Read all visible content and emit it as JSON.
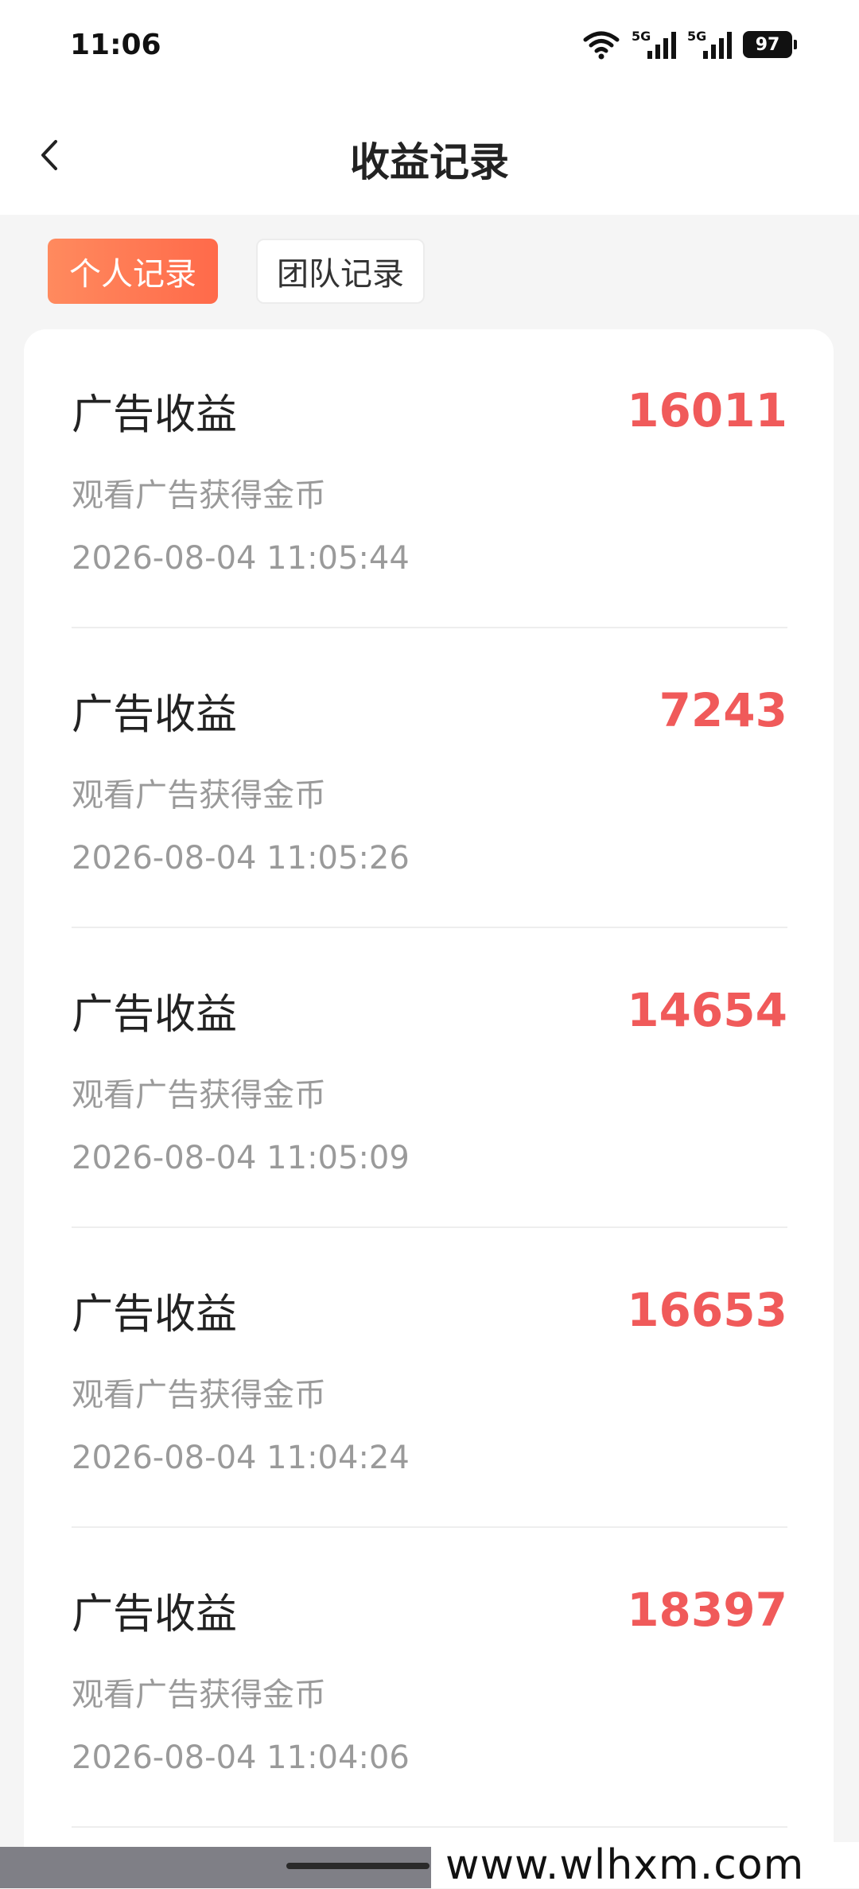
{
  "status_bar": {
    "time": "11:06",
    "network_1": "5G",
    "network_2": "5G",
    "battery": "97",
    "icons": [
      "wifi-icon",
      "signal-icon",
      "signal-icon",
      "battery-icon"
    ]
  },
  "header": {
    "title": "收益记录",
    "back_icon": "chevron-left-icon"
  },
  "tabs": [
    {
      "label": "个人记录",
      "active": true
    },
    {
      "label": "团队记录",
      "active": false
    }
  ],
  "records": [
    {
      "title": "广告收益",
      "desc": "观看广告获得金币",
      "time": "2026-08-04 11:05:44",
      "amount": "16011"
    },
    {
      "title": "广告收益",
      "desc": "观看广告获得金币",
      "time": "2026-08-04 11:05:26",
      "amount": "7243"
    },
    {
      "title": "广告收益",
      "desc": "观看广告获得金币",
      "time": "2026-08-04 11:05:09",
      "amount": "14654"
    },
    {
      "title": "广告收益",
      "desc": "观看广告获得金币",
      "time": "2026-08-04 11:04:24",
      "amount": "16653"
    },
    {
      "title": "广告收益",
      "desc": "观看广告获得金币",
      "time": "2026-08-04 11:04:06",
      "amount": "18397"
    }
  ],
  "colors": {
    "accent_gradient_start": "#ff8a5e",
    "accent_gradient_end": "#ff6a4a",
    "amount": "#f05a5a"
  },
  "watermark": "www.wlhxm.com"
}
